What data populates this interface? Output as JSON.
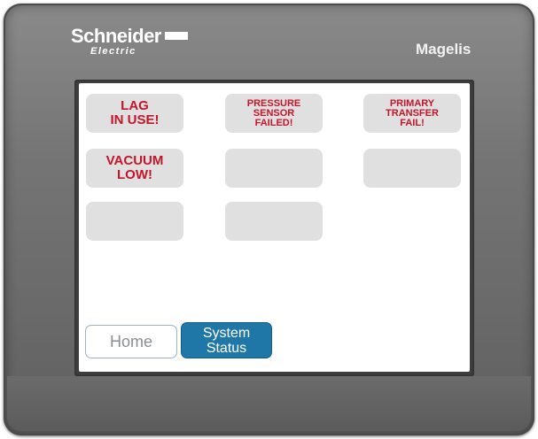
{
  "device": {
    "brand": "Schneider",
    "brand_sub": "Electric",
    "model": "Magelis"
  },
  "alarms": [
    {
      "label": "LAG\nIN USE!",
      "active": true
    },
    {
      "label": "PRESSURE\nSENSOR\nFAILED!",
      "active": true
    },
    {
      "label": "PRIMARY\nTRANSFER\nFAIL!",
      "active": true
    },
    {
      "label": "VACUUM\nLOW!",
      "active": true
    },
    {
      "label": "",
      "active": false
    },
    {
      "label": "",
      "active": false
    },
    {
      "label": "",
      "active": false
    },
    {
      "label": "",
      "active": false
    }
  ],
  "nav": {
    "home_label": "Home",
    "status_label": "System\nStatus"
  },
  "colors": {
    "alarm_text": "#c4162b",
    "tile_bg": "#e0e0e0",
    "active_button": "#1f77a8"
  }
}
